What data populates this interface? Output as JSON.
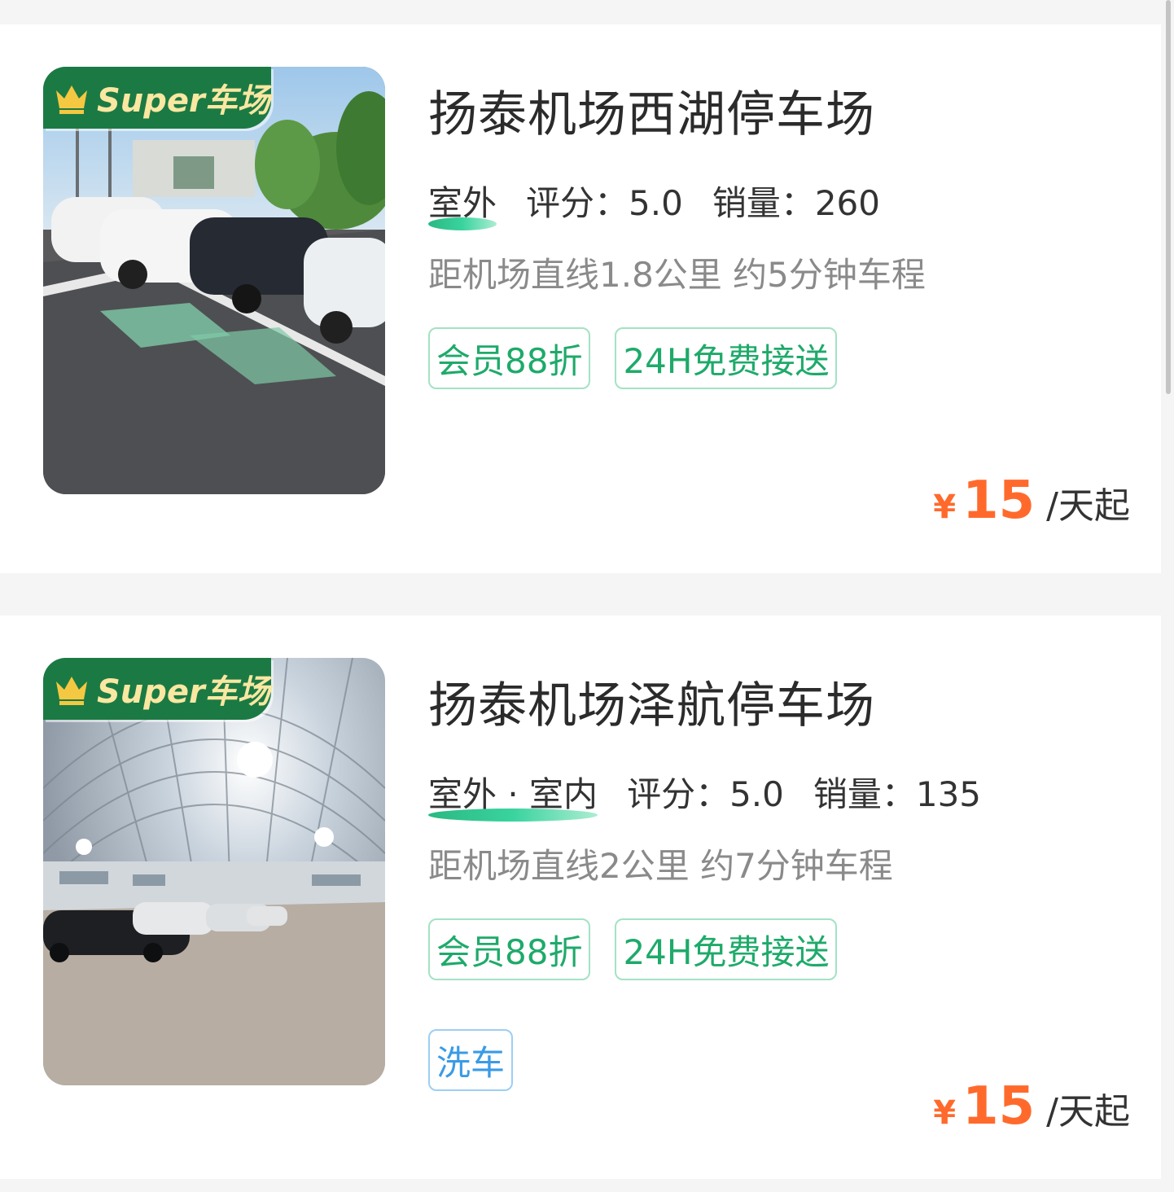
{
  "badge": {
    "label": "Super车场"
  },
  "listings": [
    {
      "title": "扬泰机场西湖停车场",
      "env": "室外",
      "rating_label": "评分：5.0",
      "sales_label": "销量：260",
      "distance": "距机场直线1.8公里 约5分钟车程",
      "tags": [
        "会员88折",
        "24H免费接送"
      ],
      "price": {
        "currency": "¥",
        "amount": "15",
        "unit": "/天起"
      },
      "photo": "outdoor-parking-lot-photo"
    },
    {
      "title": "扬泰机场泽航停车场",
      "env": "室外 · 室内",
      "rating_label": "评分：5.0",
      "sales_label": "销量：135",
      "distance": "距机场直线2公里 约7分钟车程",
      "tags": [
        "会员88折",
        "24H免费接送"
      ],
      "extra_tags": [
        "洗车"
      ],
      "price": {
        "currency": "¥",
        "amount": "15",
        "unit": "/天起"
      },
      "photo": "indoor-parking-hangar-photo"
    }
  ],
  "colors": {
    "accent_green": "#1eaa6a",
    "price_orange": "#ff6a2c",
    "badge_green": "#1b7a43",
    "badge_gold": "#f9e7a2",
    "tag_blue": "#3a9be6"
  }
}
